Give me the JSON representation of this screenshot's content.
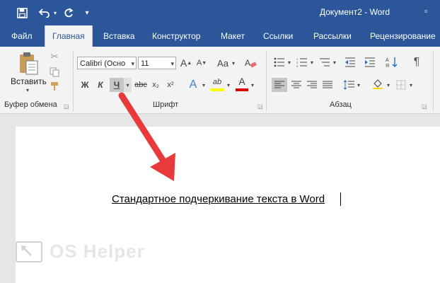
{
  "window": {
    "title": "Документ2  -  Word",
    "qat": {
      "save_icon": "save-icon",
      "undo_icon": "undo-icon",
      "redo_icon": "redo-icon",
      "customize_icon": "customize-qat-icon"
    }
  },
  "tabs": [
    "Файл",
    "Главная",
    "Вставка",
    "Конструктор",
    "Макет",
    "Ссылки",
    "Рассылки",
    "Рецензирование"
  ],
  "active_tab": "Главная",
  "ribbon": {
    "clipboard": {
      "paste_label": "Вставить",
      "group_label": "Буфер обмена"
    },
    "font": {
      "font_name": "Calibri (Осно",
      "font_size": "11",
      "bold": "Ж",
      "italic": "К",
      "underline": "Ч",
      "strike": "abc",
      "subscript": "x₂",
      "superscript": "x²",
      "text_effects": "A",
      "highlight": "ab",
      "font_color": "A",
      "grow": "A",
      "shrink": "A",
      "change_case": "Aa",
      "group_label": "Шрифт"
    },
    "paragraph": {
      "group_label": "Абзац",
      "pilcrow": "¶"
    }
  },
  "document": {
    "text": "Стандартное подчеркивание текста в Word"
  },
  "watermark": {
    "text": "OS Helper"
  },
  "colors": {
    "title_blue": "#2b579a",
    "arrow_red": "#e8393d",
    "highlight_yellow": "#ffff00",
    "font_red": "#e00000"
  }
}
